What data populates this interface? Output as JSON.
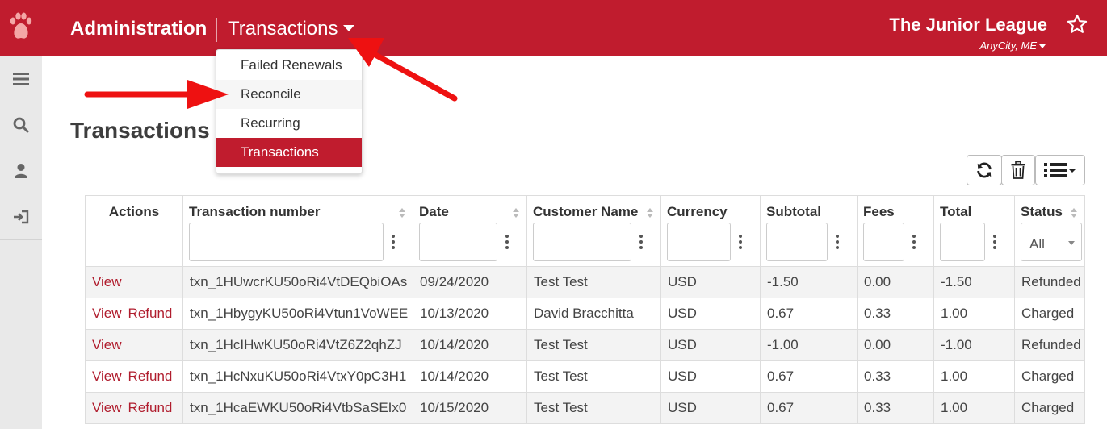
{
  "header": {
    "brand": "Administration",
    "section": "Transactions",
    "org_name": "The Junior League",
    "org_city": "AnyCity, ME"
  },
  "colors": {
    "brand": "#c01c2e",
    "link": "#b01d2e",
    "annotation": "#ee1111"
  },
  "sidebar": {
    "items": [
      {
        "icon": "menu-icon"
      },
      {
        "icon": "search-icon"
      },
      {
        "icon": "user-icon"
      },
      {
        "icon": "sign-out-icon"
      }
    ]
  },
  "dropdown": {
    "items": [
      {
        "label": "Failed Renewals"
      },
      {
        "label": "Reconcile"
      },
      {
        "label": "Recurring"
      },
      {
        "label": "Transactions"
      }
    ],
    "hovered": "Reconcile",
    "active": "Transactions"
  },
  "page": {
    "title": "Transactions"
  },
  "toolbar": {
    "icons": [
      "refresh-icon",
      "trash-icon",
      "list-columns-icon"
    ]
  },
  "table": {
    "columns": [
      "Actions",
      "Transaction number",
      "Date",
      "Customer Name",
      "Currency",
      "Subtotal",
      "Fees",
      "Total",
      "Status"
    ],
    "status_filter": "All",
    "action_view": "View",
    "action_refund": "Refund",
    "rows": [
      {
        "refund": false,
        "txn": "txn_1HUwcrKU50oRi4VtDEQbiOAs",
        "date": "09/24/2020",
        "customer": "Test Test",
        "currency": "USD",
        "subtotal": "-1.50",
        "fees": "0.00",
        "total": "-1.50",
        "status": "Refunded"
      },
      {
        "refund": true,
        "txn": "txn_1HbygyKU50oRi4Vtun1VoWEE",
        "date": "10/13/2020",
        "customer": "David Bracchitta",
        "currency": "USD",
        "subtotal": "0.67",
        "fees": "0.33",
        "total": "1.00",
        "status": "Charged"
      },
      {
        "refund": false,
        "txn": "txn_1HcIHwKU50oRi4VtZ6Z2qhZJ",
        "date": "10/14/2020",
        "customer": "Test Test",
        "currency": "USD",
        "subtotal": "-1.00",
        "fees": "0.00",
        "total": "-1.00",
        "status": "Refunded"
      },
      {
        "refund": true,
        "txn": "txn_1HcNxuKU50oRi4VtxY0pC3H1",
        "date": "10/14/2020",
        "customer": "Test Test",
        "currency": "USD",
        "subtotal": "0.67",
        "fees": "0.33",
        "total": "1.00",
        "status": "Charged"
      },
      {
        "refund": true,
        "txn": "txn_1HcaEWKU50oRi4VtbSaSEIx0",
        "date": "10/15/2020",
        "customer": "Test Test",
        "currency": "USD",
        "subtotal": "0.67",
        "fees": "0.33",
        "total": "1.00",
        "status": "Charged"
      }
    ]
  }
}
